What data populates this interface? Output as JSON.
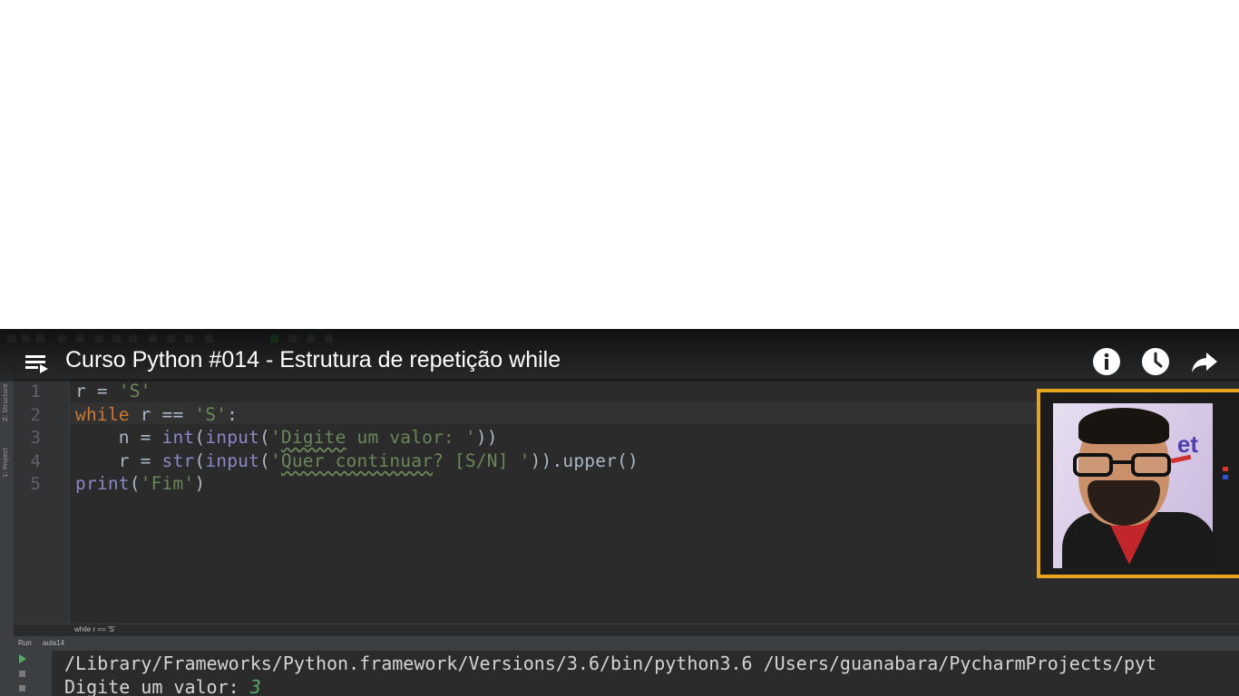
{
  "video": {
    "title": "Curso Python #014 - Estrutura de repetição while"
  },
  "overlay_icons": [
    "playlist-icon",
    "info-icon",
    "watch-later-icon",
    "share-icon"
  ],
  "editor": {
    "line_numbers": [
      "1",
      "2",
      "3",
      "4",
      "5"
    ],
    "breadcrumb": "while r == 'S'"
  },
  "run_panel": {
    "label": "Run",
    "config": "aula14",
    "console_path": "/Library/Frameworks/Python.framework/Versions/3.6/bin/python3.6 /Users/guanabara/PycharmProjects/pyt",
    "prompt": "Digite um valor: ",
    "user_input": "3"
  },
  "webcam": {
    "logo_text": "et"
  },
  "colors": {
    "editor_bg": "#2b2b2b",
    "keyword": "#cc7832",
    "string": "#6a8759",
    "builtin": "#8888c6",
    "text": "#a9b7c6",
    "webcam_border": "#e8a321"
  }
}
